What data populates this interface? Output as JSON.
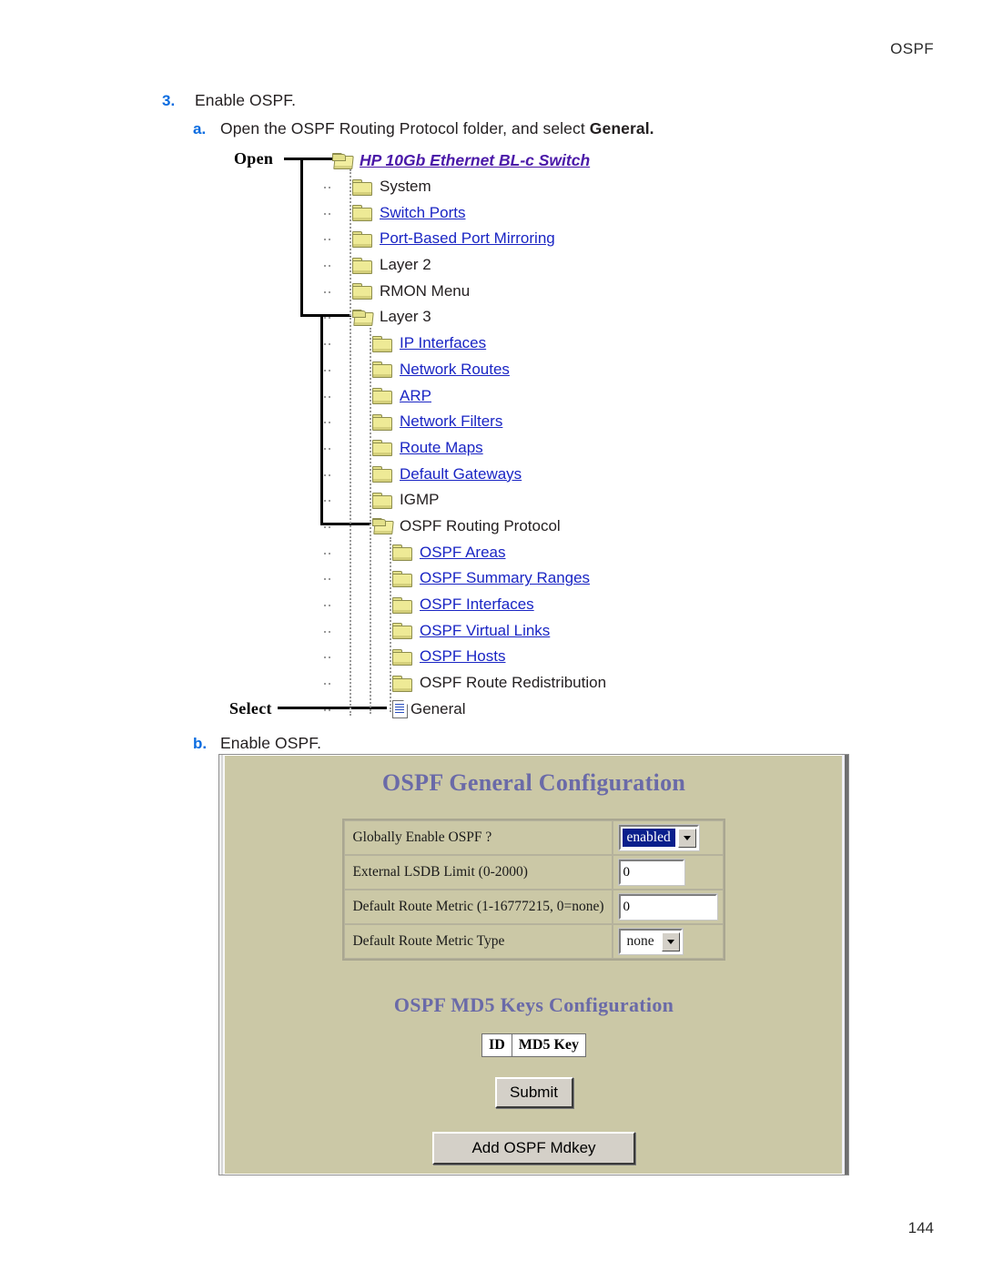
{
  "page": {
    "running_head": "OSPF",
    "folio": "144"
  },
  "steps": {
    "step3": {
      "marker": "3.",
      "text": "Enable OSPF."
    },
    "step3a": {
      "marker": "a.",
      "text_before": "Open the OSPF Routing Protocol folder, and select ",
      "text_bold": "General."
    },
    "step3b": {
      "marker": "b.",
      "text": "Enable OSPF."
    }
  },
  "callouts": {
    "open": "Open",
    "select": "Select"
  },
  "tree": {
    "nodes": [
      {
        "label": "HP 10Gb Ethernet BL-c Switch",
        "level": 1,
        "icon": "open-folder-icon",
        "style": "root-link"
      },
      {
        "label": "System",
        "level": 2,
        "icon": "folder-icon",
        "style": "plain"
      },
      {
        "label": "Switch Ports",
        "level": 2,
        "icon": "folder-icon",
        "style": "link"
      },
      {
        "label": "Port-Based Port Mirroring",
        "level": 2,
        "icon": "folder-icon",
        "style": "link"
      },
      {
        "label": "Layer 2",
        "level": 2,
        "icon": "folder-icon",
        "style": "plain"
      },
      {
        "label": "RMON Menu",
        "level": 2,
        "icon": "folder-icon",
        "style": "plain"
      },
      {
        "label": "Layer 3",
        "level": 2,
        "icon": "open-folder-icon",
        "style": "plain"
      },
      {
        "label": "IP Interfaces",
        "level": 3,
        "icon": "folder-icon",
        "style": "link"
      },
      {
        "label": "Network Routes",
        "level": 3,
        "icon": "folder-icon",
        "style": "link"
      },
      {
        "label": "ARP",
        "level": 3,
        "icon": "folder-icon",
        "style": "link"
      },
      {
        "label": "Network Filters",
        "level": 3,
        "icon": "folder-icon",
        "style": "link"
      },
      {
        "label": "Route Maps",
        "level": 3,
        "icon": "folder-icon",
        "style": "link"
      },
      {
        "label": "Default Gateways",
        "level": 3,
        "icon": "folder-icon",
        "style": "link"
      },
      {
        "label": "IGMP",
        "level": 3,
        "icon": "folder-icon",
        "style": "plain"
      },
      {
        "label": "OSPF Routing Protocol",
        "level": 3,
        "icon": "open-folder-icon",
        "style": "plain"
      },
      {
        "label": "OSPF Areas",
        "level": 4,
        "icon": "folder-icon",
        "style": "link"
      },
      {
        "label": "OSPF Summary Ranges",
        "level": 4,
        "icon": "folder-icon",
        "style": "link"
      },
      {
        "label": "OSPF Interfaces",
        "level": 4,
        "icon": "folder-icon",
        "style": "link"
      },
      {
        "label": "OSPF Virtual Links",
        "level": 4,
        "icon": "folder-icon",
        "style": "link"
      },
      {
        "label": "OSPF Hosts",
        "level": 4,
        "icon": "folder-icon",
        "style": "link"
      },
      {
        "label": "OSPF Route Redistribution",
        "level": 4,
        "icon": "folder-icon",
        "style": "plain"
      },
      {
        "label": "General",
        "level": 4,
        "icon": "document-icon",
        "style": "plain"
      }
    ]
  },
  "panel": {
    "general_title": "OSPF General Configuration",
    "md5_title": "OSPF MD5 Keys Configuration",
    "fields": [
      {
        "label": "Globally Enable OSPF ?",
        "control": "select",
        "value": "enabled",
        "highlighted": true
      },
      {
        "label": "External LSDB Limit (0-2000)",
        "control": "text",
        "value": "0"
      },
      {
        "label": "Default Route Metric (1-16777215, 0=none)",
        "control": "text",
        "value": "0"
      },
      {
        "label": "Default Route Metric Type",
        "control": "select",
        "value": "none",
        "highlighted": false
      }
    ],
    "md5_table": {
      "columns": [
        "ID",
        "MD5 Key"
      ]
    },
    "submit_label": "Submit",
    "add_mdkey_label": "Add OSPF Mdkey"
  },
  "colors": {
    "panel_background": "#cbc8a6",
    "panel_title": "#6a6aa8",
    "link": "#1a25c4",
    "root_link": "#4a18a8",
    "step_marker": "#0a6ce0",
    "select_highlight": "#0a1f8c"
  }
}
